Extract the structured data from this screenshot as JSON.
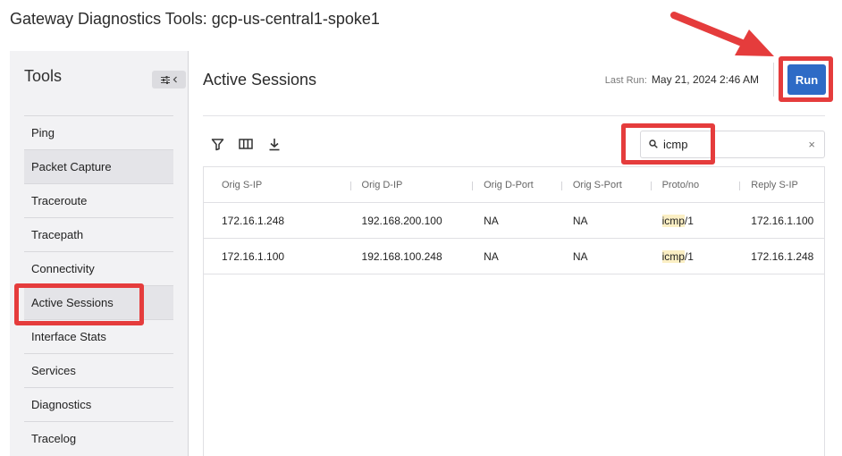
{
  "page": {
    "title": "Gateway Diagnostics Tools: gcp-us-central1-spoke1"
  },
  "sidebar": {
    "header": "Tools",
    "items": [
      {
        "label": "Ping"
      },
      {
        "label": "Packet Capture"
      },
      {
        "label": "Traceroute"
      },
      {
        "label": "Tracepath"
      },
      {
        "label": "Connectivity"
      },
      {
        "label": "Active Sessions"
      },
      {
        "label": "Interface Stats"
      },
      {
        "label": "Services"
      },
      {
        "label": "Diagnostics"
      },
      {
        "label": "Tracelog"
      }
    ]
  },
  "main": {
    "title": "Active Sessions",
    "last_run_label": "Last Run:",
    "last_run_value": "May 21, 2024 2:46 AM",
    "run_label": "Run",
    "search_value": "icmp",
    "clear_icon": "×"
  },
  "table": {
    "columns": [
      "Orig S-IP",
      "Orig D-IP",
      "Orig D-Port",
      "Orig S-Port",
      "Proto/no",
      "Reply S-IP"
    ],
    "rows": [
      {
        "orig_s_ip": "172.16.1.248",
        "orig_d_ip": "192.168.200.100",
        "orig_d_port": "NA",
        "orig_s_port": "NA",
        "proto": "icmp",
        "proto_no": "/1",
        "reply_s_ip": "172.16.1.100"
      },
      {
        "orig_s_ip": "172.16.1.100",
        "orig_d_ip": "192.168.100.248",
        "orig_d_port": "NA",
        "orig_s_port": "NA",
        "proto": "icmp",
        "proto_no": "/1",
        "reply_s_ip": "172.16.1.248"
      }
    ]
  },
  "colors": {
    "run_button": "#2e6bc6",
    "annotation": "#e53c3c",
    "highlight": "#fbefc4"
  },
  "icons": [
    "sliders-icon",
    "chevron-left-icon",
    "filter-icon",
    "columns-icon",
    "download-icon",
    "search-icon",
    "close-icon"
  ]
}
